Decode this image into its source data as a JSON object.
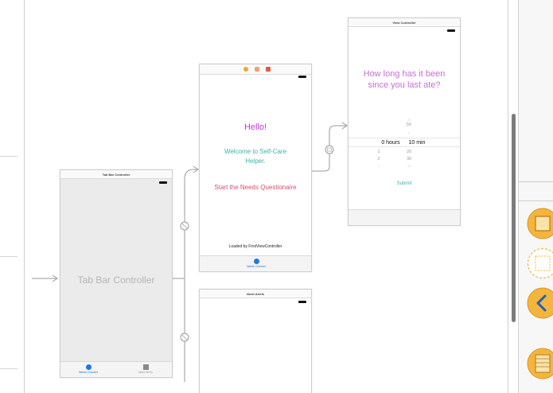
{
  "scenes": {
    "tab_bar_controller": {
      "title": "Tab Bar Controller",
      "body_label": "Tab Bar Controller",
      "tabs": [
        {
          "label": "Needs Checker",
          "icon": "blue-dot-icon"
        },
        {
          "label": "Need Alerts",
          "icon": "grey-square-icon"
        }
      ]
    },
    "hello": {
      "hello": "Hello!",
      "welcome": "Welcome to Self-Care Helper.",
      "start": "Start the Needs Questionaire",
      "loaded": "Loaded by FirstViewController",
      "tab_label": "Needs Checker"
    },
    "view_controller": {
      "title": "View Controller",
      "question": "How long has it been since you last ate?",
      "picker": {
        "minutes_above": [
          "50"
        ],
        "hours_selected": "0 hours",
        "minutes_selected": "10 min",
        "hours_below": [
          "1",
          "2"
        ],
        "minutes_below": [
          "20",
          "30"
        ]
      },
      "submit": "Submit"
    },
    "need_alerts": {
      "title": "Need Alerts"
    }
  },
  "colors": {
    "hello": "#c53bcc",
    "welcome": "#3eb3a3",
    "start": "#d4506e",
    "question": "#c56fd6",
    "tab_active": "#1a78e6",
    "library_orange": "#f5b53a"
  },
  "library_icons": [
    "view-controller-icon",
    "storyboard-reference-icon",
    "navigation-back-icon",
    "table-view-icon"
  ]
}
